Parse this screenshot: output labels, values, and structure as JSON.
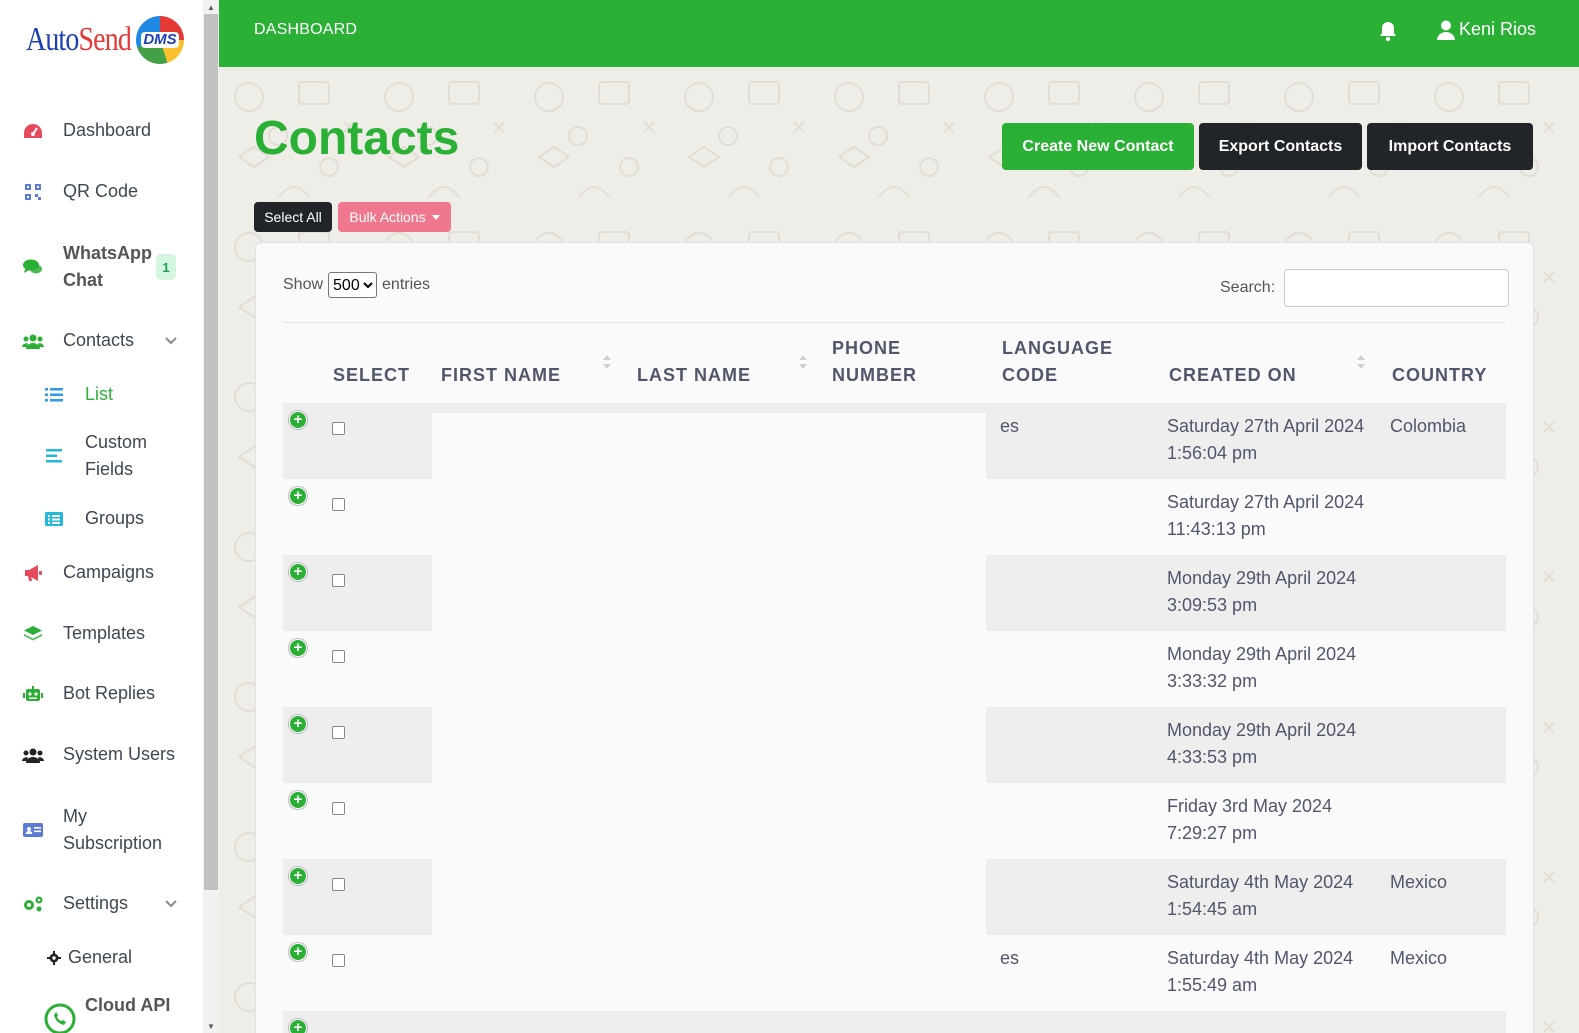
{
  "brand": {
    "logo_text_a": "Auto",
    "logo_text_b": "Send",
    "logo_badge": "DMS"
  },
  "topbar": {
    "breadcrumb": "DASHBOARD",
    "user_name": "Keni Rios",
    "bell_icon": "bell-icon",
    "user_icon": "user-icon"
  },
  "sidebar": {
    "dashboard": "Dashboard",
    "qr_code": "QR Code",
    "whatsapp_chat": "WhatsApp Chat",
    "whatsapp_badge": "1",
    "contacts": "Contacts",
    "list": "List",
    "custom_fields": "Custom Fields",
    "groups": "Groups",
    "campaigns": "Campaigns",
    "templates": "Templates",
    "bot_replies": "Bot Replies",
    "system_users": "System Users",
    "my_subscription": "My Subscription",
    "settings": "Settings",
    "general": "General",
    "cloud_api": "Cloud API",
    "active_color": "#2bb036"
  },
  "page": {
    "title": "Contacts",
    "create_btn": "Create New Contact",
    "export_btn": "Export Contacts",
    "import_btn": "Import Contacts",
    "select_all_btn": "Select All",
    "bulk_actions_btn": "Bulk Actions",
    "show_label": "Show",
    "entries_value": "500",
    "entries_label": "entries",
    "search_label": "Search:",
    "search_value": ""
  },
  "table": {
    "headers": {
      "select": "SELECT",
      "first_name": "FIRST NAME",
      "last_name": "LAST NAME",
      "phone_a": "PHONE",
      "phone_b": "NUMBER",
      "lang_a": "LANGUAGE",
      "lang_b": "CODE",
      "created_on": "CREATED ON",
      "country": "COUNTRY"
    },
    "rows": [
      {
        "lang": "es",
        "date": "Saturday 27th April 2024",
        "time": "1:56:04 pm",
        "country": "Colombia"
      },
      {
        "lang": "",
        "date": "Saturday 27th April 2024",
        "time": "11:43:13 pm",
        "country": ""
      },
      {
        "lang": "",
        "date": "Monday 29th April 2024",
        "time": "3:09:53 pm",
        "country": ""
      },
      {
        "lang": "",
        "date": "Monday 29th April 2024",
        "time": "3:33:32 pm",
        "country": ""
      },
      {
        "lang": "",
        "date": "Monday 29th April 2024",
        "time": "4:33:53 pm",
        "country": ""
      },
      {
        "lang": "",
        "date": "Friday 3rd May 2024",
        "time": "7:29:27 pm",
        "country": ""
      },
      {
        "lang": "",
        "date": "Saturday 4th May 2024",
        "time": "1:54:45 am",
        "country": "Mexico"
      },
      {
        "lang": "es",
        "date": "Saturday 4th May 2024",
        "time": "1:55:49 am",
        "country": "Mexico"
      }
    ]
  },
  "colors": {
    "primary": "#2bb036",
    "dark": "#212529",
    "bulk": "#f0788e"
  }
}
